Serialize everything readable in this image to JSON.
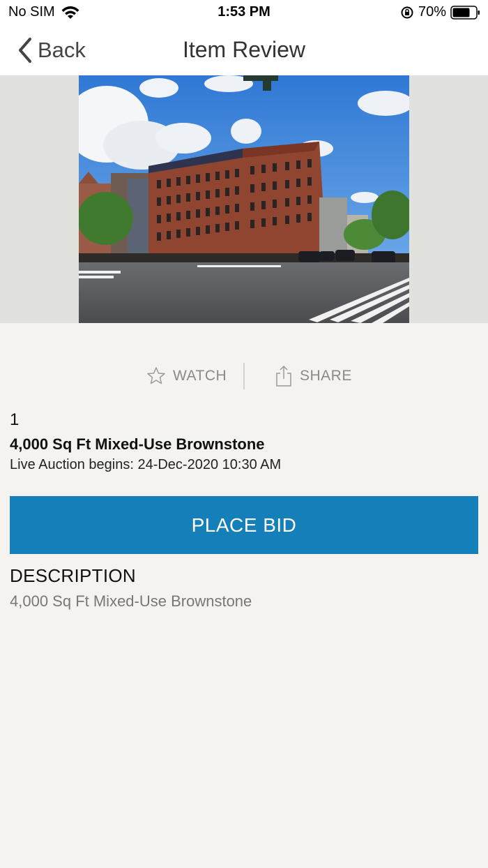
{
  "status_bar": {
    "carrier": "No SIM",
    "time": "1:53 PM",
    "battery": "70%"
  },
  "nav": {
    "back_label": "Back",
    "title": "Item Review"
  },
  "actions": {
    "watch_label": "WATCH",
    "share_label": "SHARE"
  },
  "item": {
    "lot_number": "1",
    "title": "4,000 Sq Ft Mixed-Use Brownstone",
    "auction_info": "Live Auction begins: 24-Dec-2020 10:30 AM",
    "bid_label": "PLACE BID",
    "description_heading": "DESCRIPTION",
    "description": "4,000 Sq Ft Mixed-Use Brownstone"
  },
  "colors": {
    "accent": "#157fba",
    "page_bg": "#f4f3f0",
    "image_bg": "#e1e1dd"
  },
  "icons": [
    "wifi-icon",
    "orientation-lock-icon",
    "battery-icon",
    "chevron-left-icon",
    "star-icon",
    "share-icon"
  ]
}
